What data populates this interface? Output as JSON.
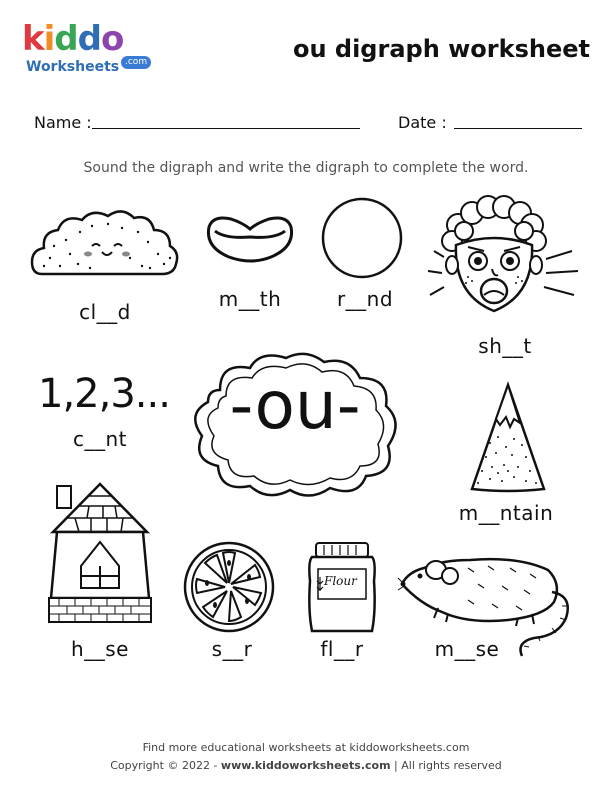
{
  "brand": {
    "logo_letters": [
      "k",
      "i",
      "d",
      "d",
      "o"
    ],
    "logo_colors": [
      "#e03a3e",
      "#f28c28",
      "#3aa655",
      "#2f6db5",
      "#8e44ad"
    ],
    "sub_text": "Worksheets",
    "domain_badge": ".com"
  },
  "title": "ou digraph worksheet",
  "form": {
    "name_label": "Name :",
    "date_label": "Date :"
  },
  "instruction": "Sound the digraph and write the digraph to complete the word.",
  "center_text": "-ou-",
  "numbers_text": "1,2,3...",
  "flour_label": "Flour",
  "words": {
    "cloud": "cl__d",
    "mouth": "m__th",
    "round": "r__nd",
    "shout": "sh__t",
    "count": "c__nt",
    "mountain": "m__ntain",
    "house": "h__se",
    "sour": "s__r",
    "flour": "fl__r",
    "mouse": "m__se"
  },
  "footer": {
    "line1": "Find more educational worksheets at kiddoworksheets.com",
    "line2_left": "Copyright © 2022 - ",
    "line2_site": "www.kiddoworksheets.com",
    "line2_right": "  |  All rights reserved"
  }
}
